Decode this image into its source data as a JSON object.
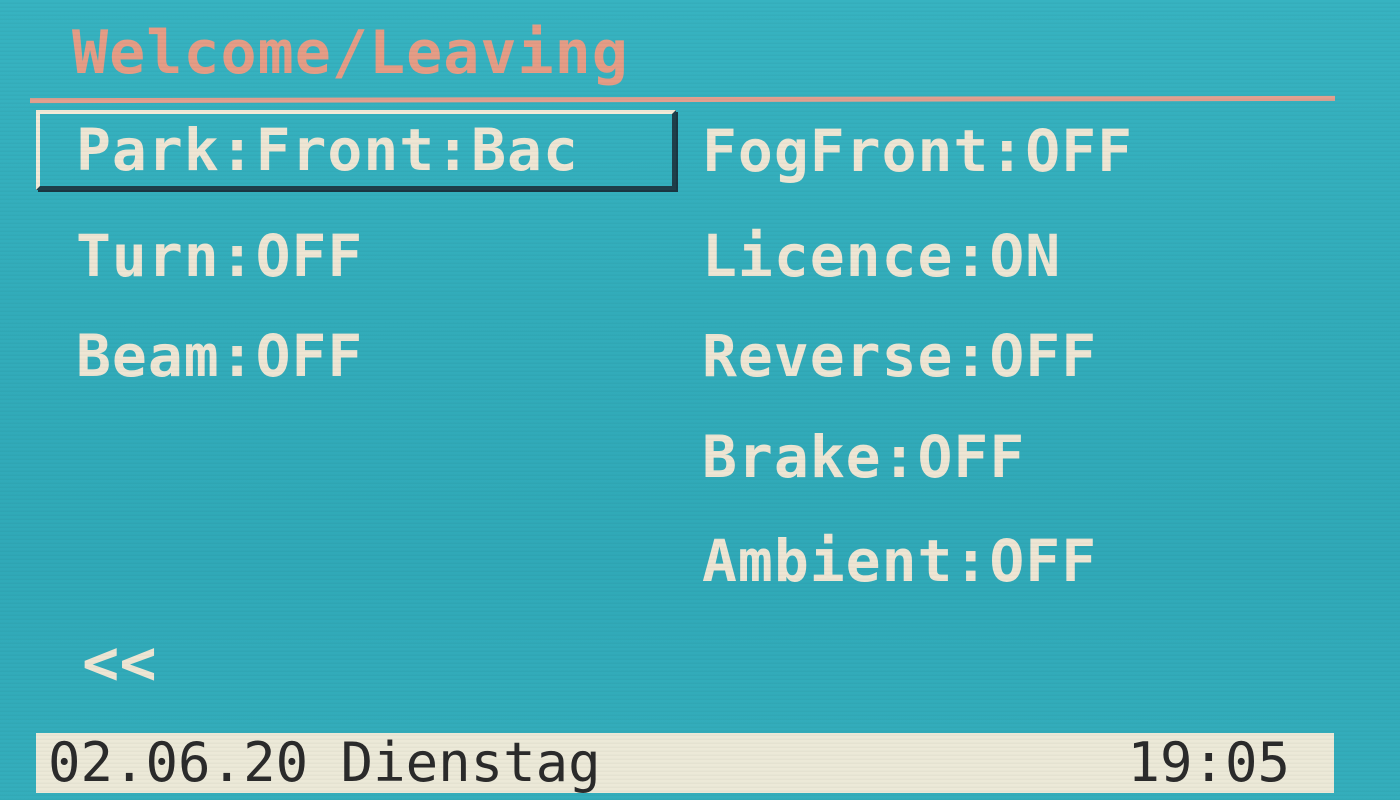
{
  "header": {
    "title": "Welcome/Leaving",
    "title_color": "#e59d86"
  },
  "menu": {
    "left": [
      {
        "label": "Park:Front:Bac",
        "selected": true
      },
      {
        "label": "Turn:OFF"
      },
      {
        "label": "Beam:OFF"
      }
    ],
    "right": [
      {
        "label": "FogFront:OFF"
      },
      {
        "label": "Licence:ON"
      },
      {
        "label": "Reverse:OFF"
      },
      {
        "label": "Brake:OFF"
      },
      {
        "label": "Ambient:OFF"
      }
    ]
  },
  "navigation": {
    "back_label": "<<",
    "back_icon": "double-chevron-left-icon"
  },
  "status_bar": {
    "date": "02.06.20 Dienstag",
    "time": "19:05"
  },
  "colors": {
    "screen_background": "#32acba",
    "text": "#eee6d4",
    "status_bar_background": "#ece9d8",
    "status_bar_text": "#2b2b2b"
  }
}
